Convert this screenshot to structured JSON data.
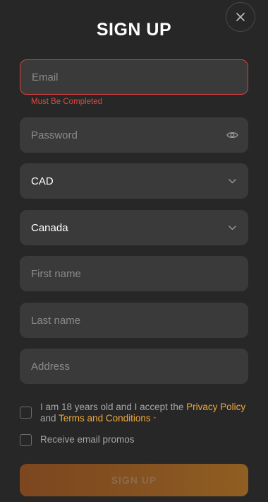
{
  "title": "SIGN UP",
  "email": {
    "placeholder": "Email",
    "error": "Must Be Completed"
  },
  "password": {
    "placeholder": "Password"
  },
  "currency": {
    "value": "CAD"
  },
  "country": {
    "value": "Canada"
  },
  "first_name": {
    "placeholder": "First name"
  },
  "last_name": {
    "placeholder": "Last name"
  },
  "address": {
    "placeholder": "Address"
  },
  "terms": {
    "prefix": "I am 18 years old and I accept the",
    "privacy_link": "Privacy Policy",
    "and": "and",
    "terms_link": "Terms and Conditions",
    "required_marker": "*"
  },
  "promos": {
    "label": "Receive email promos"
  },
  "submit": {
    "label": "SIGN UP"
  },
  "colors": {
    "background": "#272727",
    "field": "#3a3a3a",
    "error": "#e0493f",
    "link": "#f3a93b",
    "button": "#845121"
  },
  "icons": {
    "close": "close-icon",
    "password_toggle": "eye-icon",
    "dropdown": "chevron-down-icon"
  }
}
